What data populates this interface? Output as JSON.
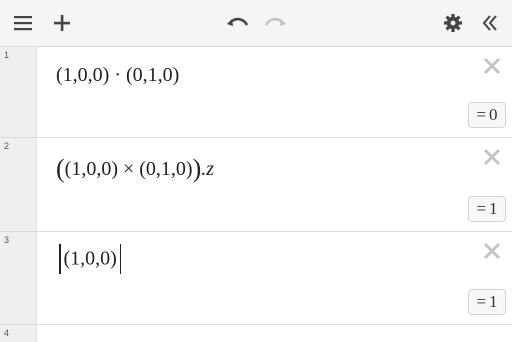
{
  "toolbar": {
    "icons": [
      "menu-icon",
      "add-icon",
      "undo-icon",
      "redo-icon",
      "settings-icon",
      "collapse-icon"
    ]
  },
  "rows": [
    {
      "number": "1",
      "expression": "(1,0,0) · (0,1,0)",
      "result": "0"
    },
    {
      "number": "2",
      "expression_open": "(",
      "expression_inner": "(1,0,0) × (0,1,0)",
      "expression_close": ")",
      "expression_suffix": ".z",
      "result": "1"
    },
    {
      "number": "3",
      "expression_inner": "(1,0,0)",
      "result": "1"
    },
    {
      "number": "4"
    }
  ],
  "result_prefix": "=",
  "colors": {
    "toolbar_bg": "#f5f5f5",
    "gutter_bg": "#efefef",
    "icon_dark": "#444444",
    "icon_disabled": "#c4c4c4",
    "divider": "#dcdcdc"
  }
}
